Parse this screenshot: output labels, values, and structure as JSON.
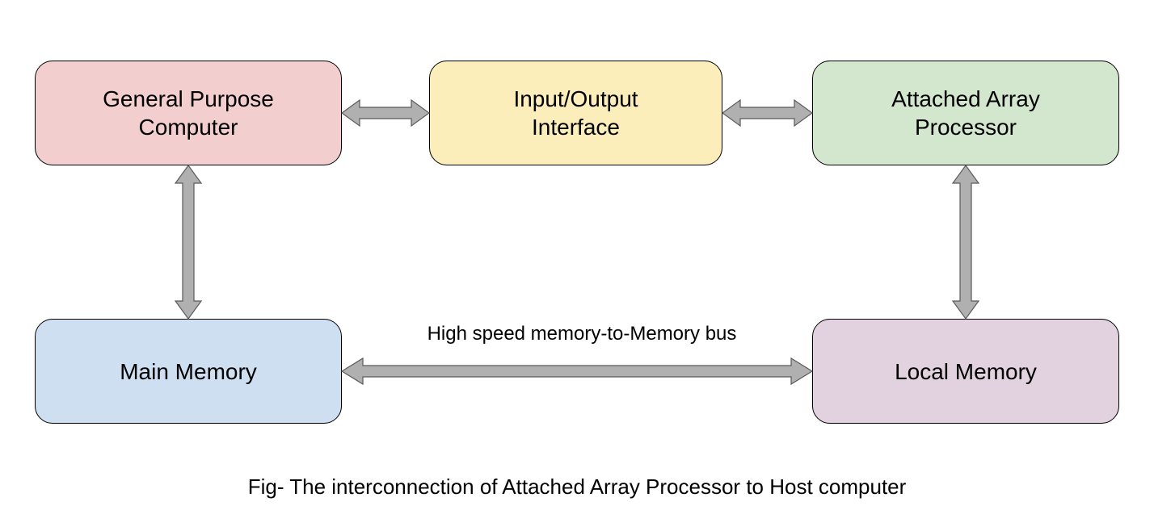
{
  "boxes": {
    "gpc": {
      "line1": "General Purpose",
      "line2": "Computer"
    },
    "io": {
      "line1": "Input/Output",
      "line2": "Interface"
    },
    "aap": {
      "line1": "Attached Array",
      "line2": "Processor"
    },
    "main": {
      "line1": "Main Memory",
      "line2": ""
    },
    "local": {
      "line1": "Local Memory",
      "line2": ""
    }
  },
  "labels": {
    "bus": "High speed memory-to-Memory bus"
  },
  "caption": "Fig- The interconnection of Attached Array Processor to Host computer",
  "colors": {
    "gpc": "#F2CFCE",
    "io": "#FBEEBB",
    "aap": "#D3E6CE",
    "main": "#CEDFF2",
    "local": "#E2D1DE",
    "arrowFill": "#B0B0B0",
    "arrowStroke": "#5A5A5A"
  }
}
